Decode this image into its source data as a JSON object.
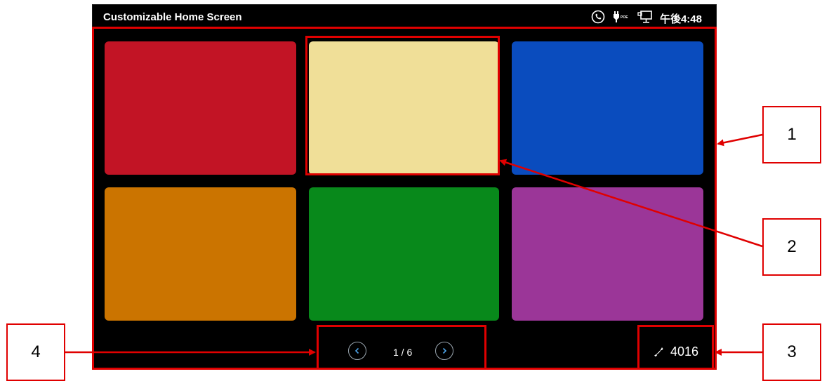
{
  "status_bar": {
    "title": "Customizable Home Screen",
    "time": "午後4:48",
    "icons": [
      "phone-status-icon",
      "poe-power-icon",
      "network-monitor-icon"
    ]
  },
  "tiles": [
    {
      "color": "#c21425"
    },
    {
      "color": "#f0df98"
    },
    {
      "color": "#0a4cbe"
    },
    {
      "color": "#cb7400"
    },
    {
      "color": "#08891b"
    },
    {
      "color": "#9b3698"
    }
  ],
  "pager": {
    "label": "1 / 6"
  },
  "extension": {
    "number": "4016"
  },
  "callouts": [
    "1",
    "2",
    "3",
    "4"
  ],
  "colors": {
    "annotation": "#e00000",
    "pager_icon": "#4da3e8"
  }
}
